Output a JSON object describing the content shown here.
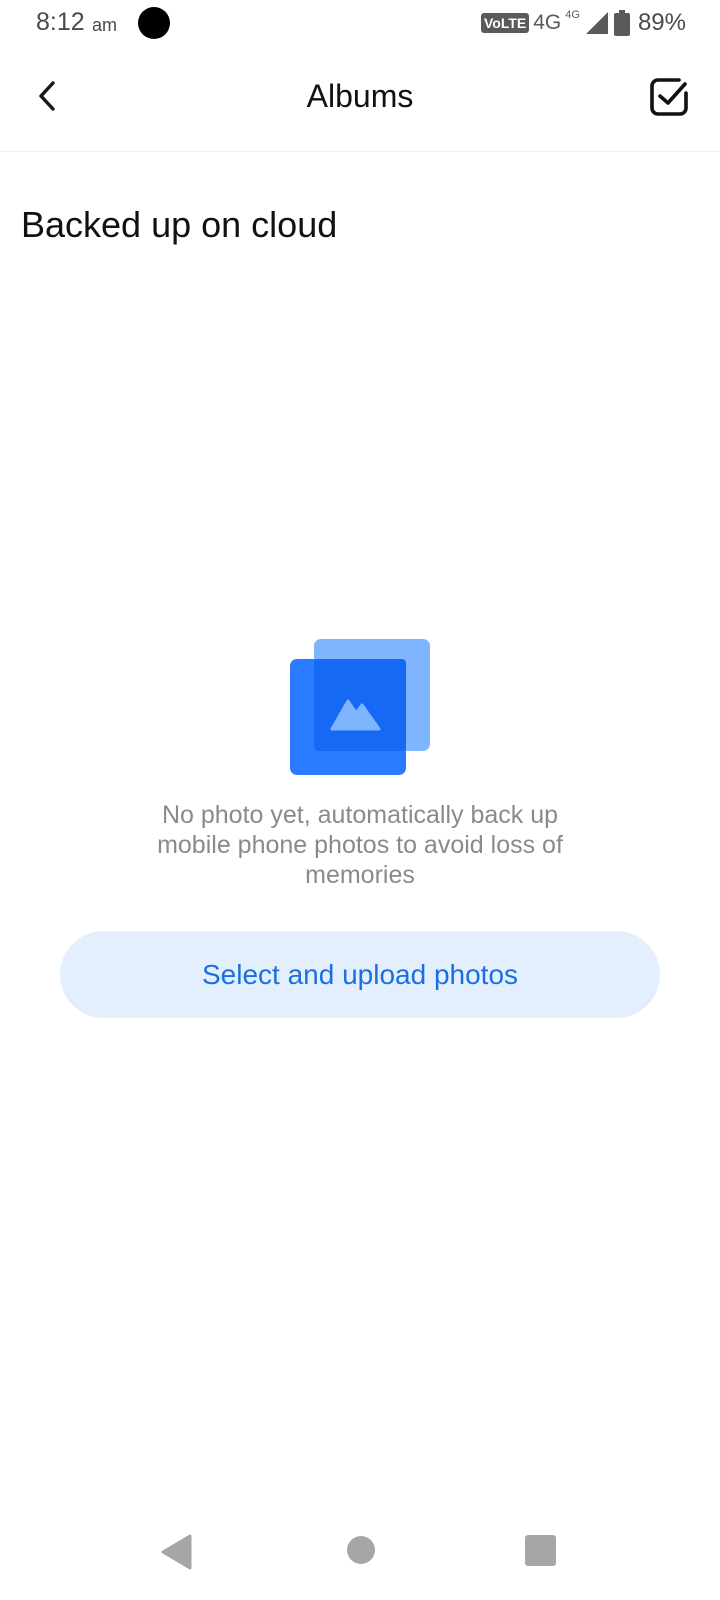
{
  "status_bar": {
    "time": "8:12",
    "ampm": "am",
    "volte": "VoLTE",
    "network": "4G",
    "network_secondary": "4G",
    "battery": "89%"
  },
  "app_bar": {
    "title": "Albums",
    "back_icon": "chevron-left-icon",
    "select_icon": "checkbox-checked-icon"
  },
  "section": {
    "title": "Backed up on cloud"
  },
  "empty_state": {
    "icon": "photo-stack-icon",
    "message": "No photo yet, automatically back up mobile phone photos to avoid loss of memories",
    "button_label": "Select and upload photos"
  },
  "colors": {
    "accent": "#1d6fe0",
    "button_bg": "#e3effc",
    "illustration_front": "#1a72ff",
    "illustration_back": "#7fb4ff",
    "muted_text": "#8a8a8a"
  },
  "nav_bar": {
    "back_icon": "triangle-back-icon",
    "home_icon": "circle-home-icon",
    "recents_icon": "square-recents-icon"
  }
}
